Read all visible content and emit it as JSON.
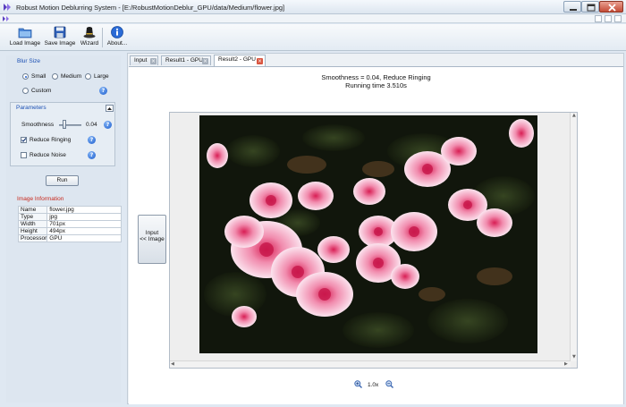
{
  "window": {
    "title": "Robust Motion Deblurring System - [E:/RobustMotionDeblur_GPU/data/Medium/flower.jpg]"
  },
  "toolbar": {
    "load_label": "Load Image",
    "save_label": "Save Image",
    "wizard_label": "Wizard",
    "about_label": "About..."
  },
  "blur_size": {
    "title": "Blur Size",
    "options": [
      "Small",
      "Medium",
      "Large",
      "Custom"
    ],
    "selected": "Small"
  },
  "parameters": {
    "title": "Parameters",
    "smoothness_label": "Smoothness",
    "smoothness_value": "0.04",
    "smoothness_level": 0.04,
    "reduce_ringing_label": "Reduce Ringing",
    "reduce_ringing_checked": true,
    "reduce_noise_label": "Reduce Noise",
    "reduce_noise_checked": false
  },
  "run_label": "Run",
  "image_info": {
    "title": "Image Information",
    "rows": [
      {
        "key": "Name",
        "value": "flower.jpg"
      },
      {
        "key": "Type",
        "value": "jpg"
      },
      {
        "key": "Width",
        "value": "701px"
      },
      {
        "key": "Height",
        "value": "494px"
      },
      {
        "key": "Processor",
        "value": "GPU"
      }
    ]
  },
  "tabs": [
    {
      "label": "Input",
      "active": false
    },
    {
      "label": "Result1 - GPU",
      "active": false
    },
    {
      "label": "Result2 - GPU",
      "active": true
    }
  ],
  "result": {
    "caption_line1": "Smoothness = 0.04, Reduce Ringing",
    "caption_line2": "Running time 3.510s",
    "input_btn_line1": "Input",
    "input_btn_line2": "<< Image",
    "zoom_level": "1.0x"
  },
  "icons": {
    "load": "folder-icon",
    "save": "floppy-icon",
    "wizard": "wizard-hat-icon",
    "about": "info-icon",
    "help": "help-icon",
    "zoom_in": "zoom-in-icon",
    "zoom_out": "zoom-out-icon"
  },
  "colors": {
    "section_blue": "#1a4fb3",
    "section_red": "#c8281c",
    "active_tab_close": "#d9553f"
  }
}
